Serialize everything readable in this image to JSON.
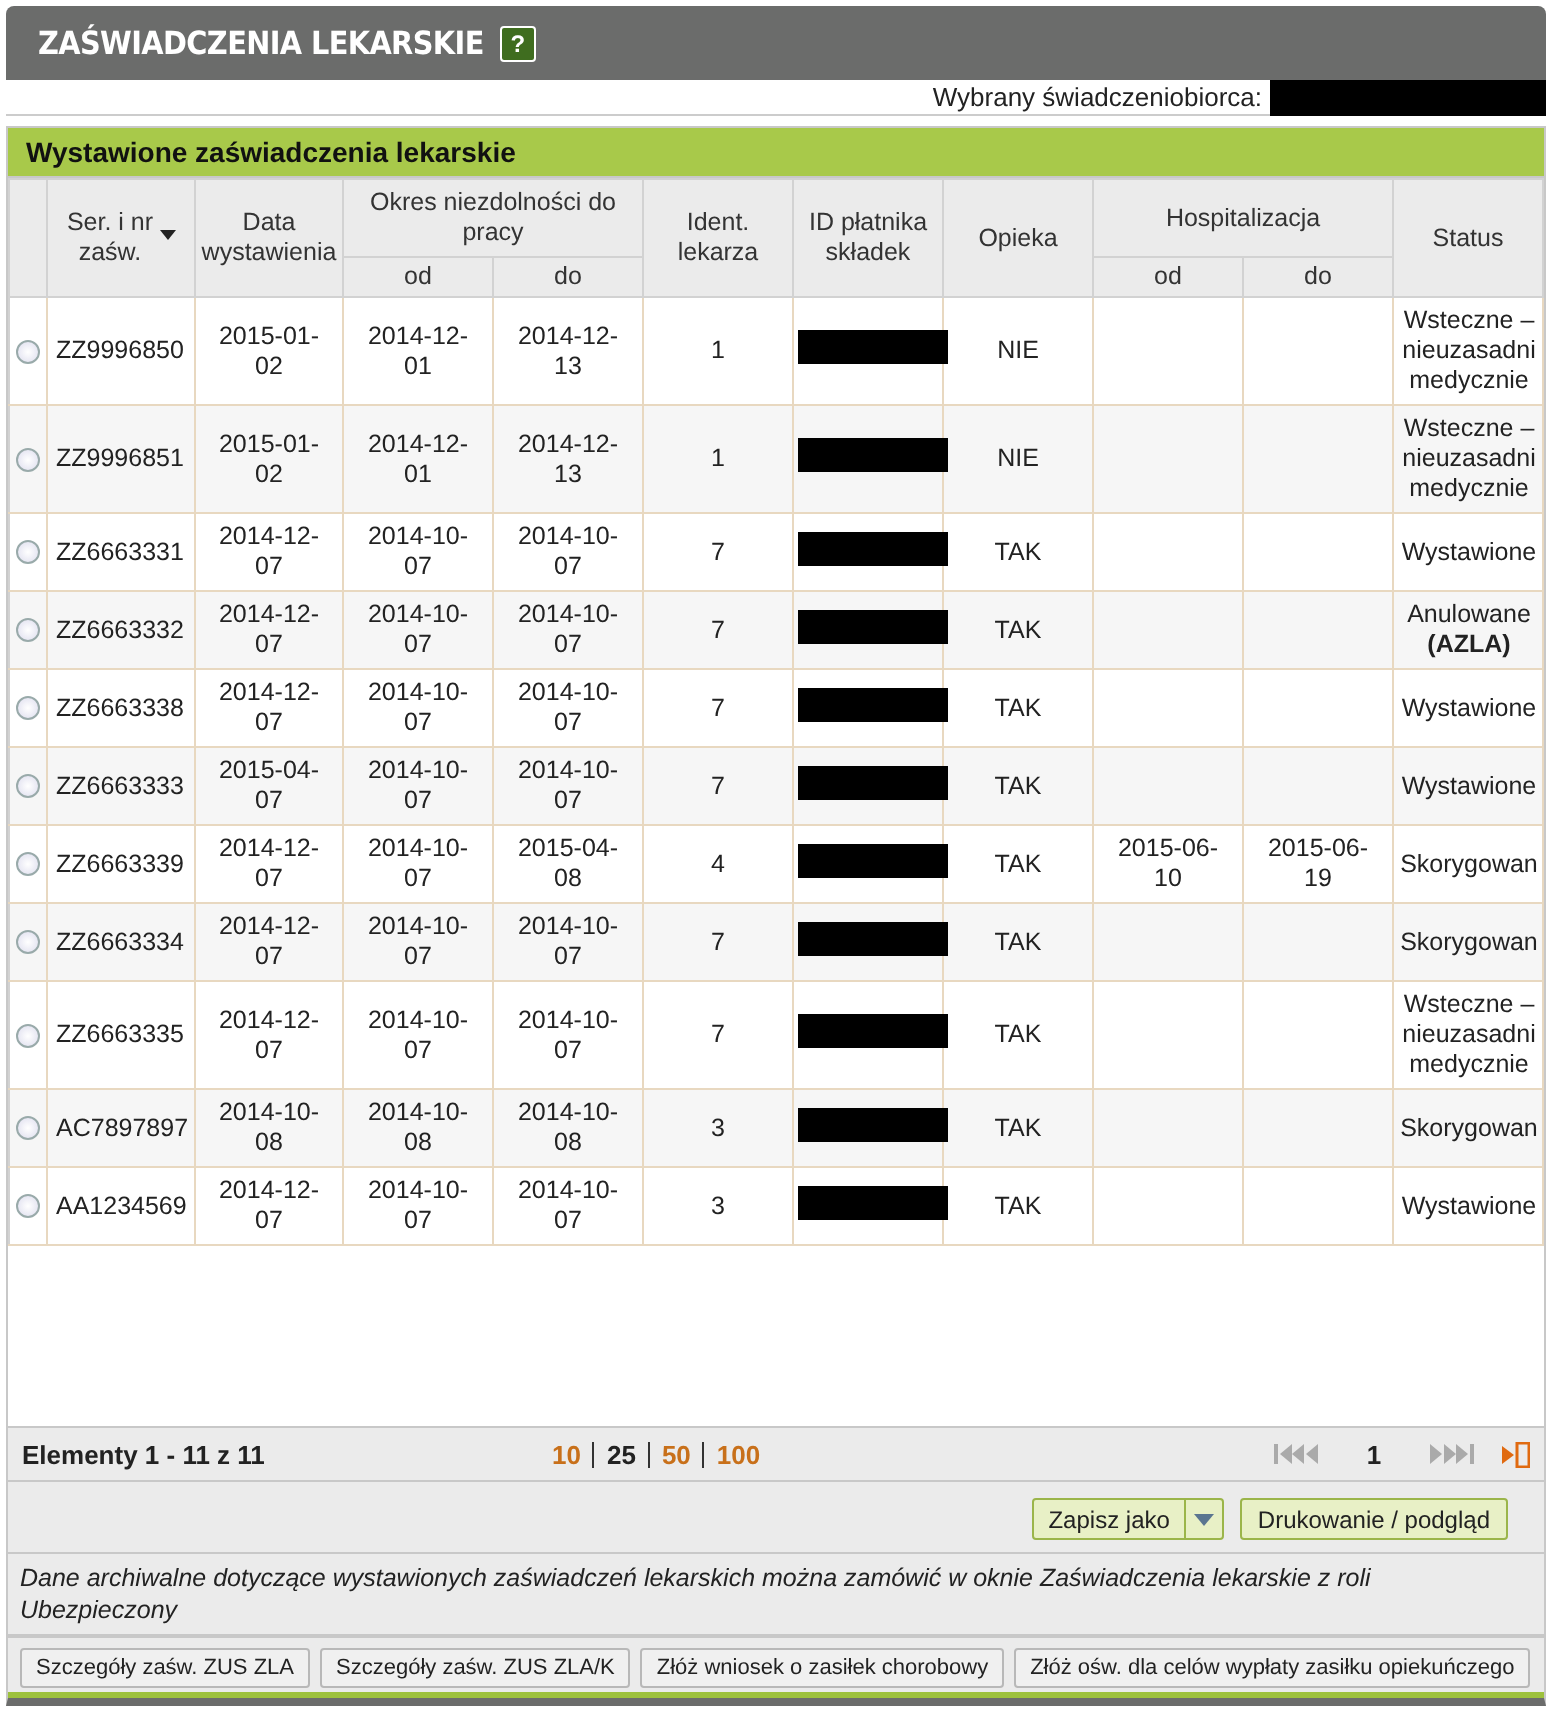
{
  "header": {
    "title": "ZAŚWIADCZENIA LEKARSKIE",
    "help": "?"
  },
  "beneficiary": {
    "label": "Wybrany świadczeniobiorca:"
  },
  "panel": {
    "title": "Wystawione zaświadczenia lekarskie"
  },
  "table": {
    "columns": {
      "series": "Ser. i nr zaśw.",
      "issued": "Data wystawienia",
      "period": "Okres niezdolności do pracy",
      "period_from": "od",
      "period_to": "do",
      "doctor": "Ident. lekarza",
      "payer": "ID płatnika składek",
      "care": "Opieka",
      "hospital": "Hospitalizacja",
      "hospital_from": "od",
      "hospital_to": "do",
      "status": "Status"
    },
    "rows": [
      {
        "selected": false,
        "series": "ZZ9996850",
        "issued": "2015-01-02",
        "from": "2014-12-01",
        "to": "2014-12-13",
        "doctor": "1",
        "care": "NIE",
        "hosp_from": "",
        "hosp_to": "",
        "status": "Wsteczne – nieuzasadni medycznie"
      },
      {
        "selected": false,
        "series": "ZZ9996851",
        "issued": "2015-01-02",
        "from": "2014-12-01",
        "to": "2014-12-13",
        "doctor": "1",
        "care": "NIE",
        "hosp_from": "",
        "hosp_to": "",
        "status": "Wsteczne – nieuzasadni medycznie"
      },
      {
        "selected": false,
        "series": "ZZ6663331",
        "issued": "2014-12-07",
        "from": "2014-10-07",
        "to": "2014-10-07",
        "doctor": "7",
        "care": "TAK",
        "hosp_from": "",
        "hosp_to": "",
        "status": "Wystawione"
      },
      {
        "selected": false,
        "series": "ZZ6663332",
        "issued": "2014-12-07",
        "from": "2014-10-07",
        "to": "2014-10-07",
        "doctor": "7",
        "care": "TAK",
        "hosp_from": "",
        "hosp_to": "",
        "status": "Anulowane **(AZLA)**"
      },
      {
        "selected": false,
        "series": "ZZ6663338",
        "issued": "2014-12-07",
        "from": "2014-10-07",
        "to": "2014-10-07",
        "doctor": "7",
        "care": "TAK",
        "hosp_from": "",
        "hosp_to": "",
        "status": "Wystawione"
      },
      {
        "selected": false,
        "series": "ZZ6663333",
        "issued": "2015-04-07",
        "from": "2014-10-07",
        "to": "2014-10-07",
        "doctor": "7",
        "care": "TAK",
        "hosp_from": "",
        "hosp_to": "",
        "status": "Wystawione"
      },
      {
        "selected": false,
        "series": "ZZ6663339",
        "issued": "2014-12-07",
        "from": "2014-10-07",
        "to": "2015-04-08",
        "doctor": "4",
        "care": "TAK",
        "hosp_from": "2015-06-10",
        "hosp_to": "2015-06-19",
        "status": "Skorygowan"
      },
      {
        "selected": false,
        "series": "ZZ6663334",
        "issued": "2014-12-07",
        "from": "2014-10-07",
        "to": "2014-10-07",
        "doctor": "7",
        "care": "TAK",
        "hosp_from": "",
        "hosp_to": "",
        "status": "Skorygowan"
      },
      {
        "selected": false,
        "series": "ZZ6663335",
        "issued": "2014-12-07",
        "from": "2014-10-07",
        "to": "2014-10-07",
        "doctor": "7",
        "care": "TAK",
        "hosp_from": "",
        "hosp_to": "",
        "status": "Wsteczne – nieuzasadni medycznie"
      },
      {
        "selected": false,
        "series": "AC7897897",
        "issued": "2014-10-08",
        "from": "2014-10-08",
        "to": "2014-10-08",
        "doctor": "3",
        "care": "TAK",
        "hosp_from": "",
        "hosp_to": "",
        "status": "Skorygowan"
      },
      {
        "selected": false,
        "series": "AA1234569",
        "issued": "2014-12-07",
        "from": "2014-10-07",
        "to": "2014-10-07",
        "doctor": "3",
        "care": "TAK",
        "hosp_from": "",
        "hosp_to": "",
        "status": "Wystawione"
      }
    ]
  },
  "pager": {
    "summary": "Elementy 1 - 11 z 11",
    "page_sizes": [
      {
        "label": "10",
        "selected": false
      },
      {
        "label": "25",
        "selected": true
      },
      {
        "label": "50",
        "selected": false
      },
      {
        "label": "100",
        "selected": false
      }
    ],
    "page": "1"
  },
  "actions": {
    "save": "Zapisz jako",
    "print": "Drukowanie / podgląd"
  },
  "note": "Dane archiwalne dotyczące wystawionych zaświadczeń lekarskich można zamówić w oknie Zaświadczenia lekarskie z roli Ubezpieczony",
  "buttons": [
    "Szczegóły zaśw. ZUS ZLA",
    "Szczegóły zaśw. ZUS ZLA/K",
    "Złóż wniosek o zasiłek chorobowy",
    "Złóż ośw. dla celów wypłaty zasiłku opiekuńczego"
  ]
}
